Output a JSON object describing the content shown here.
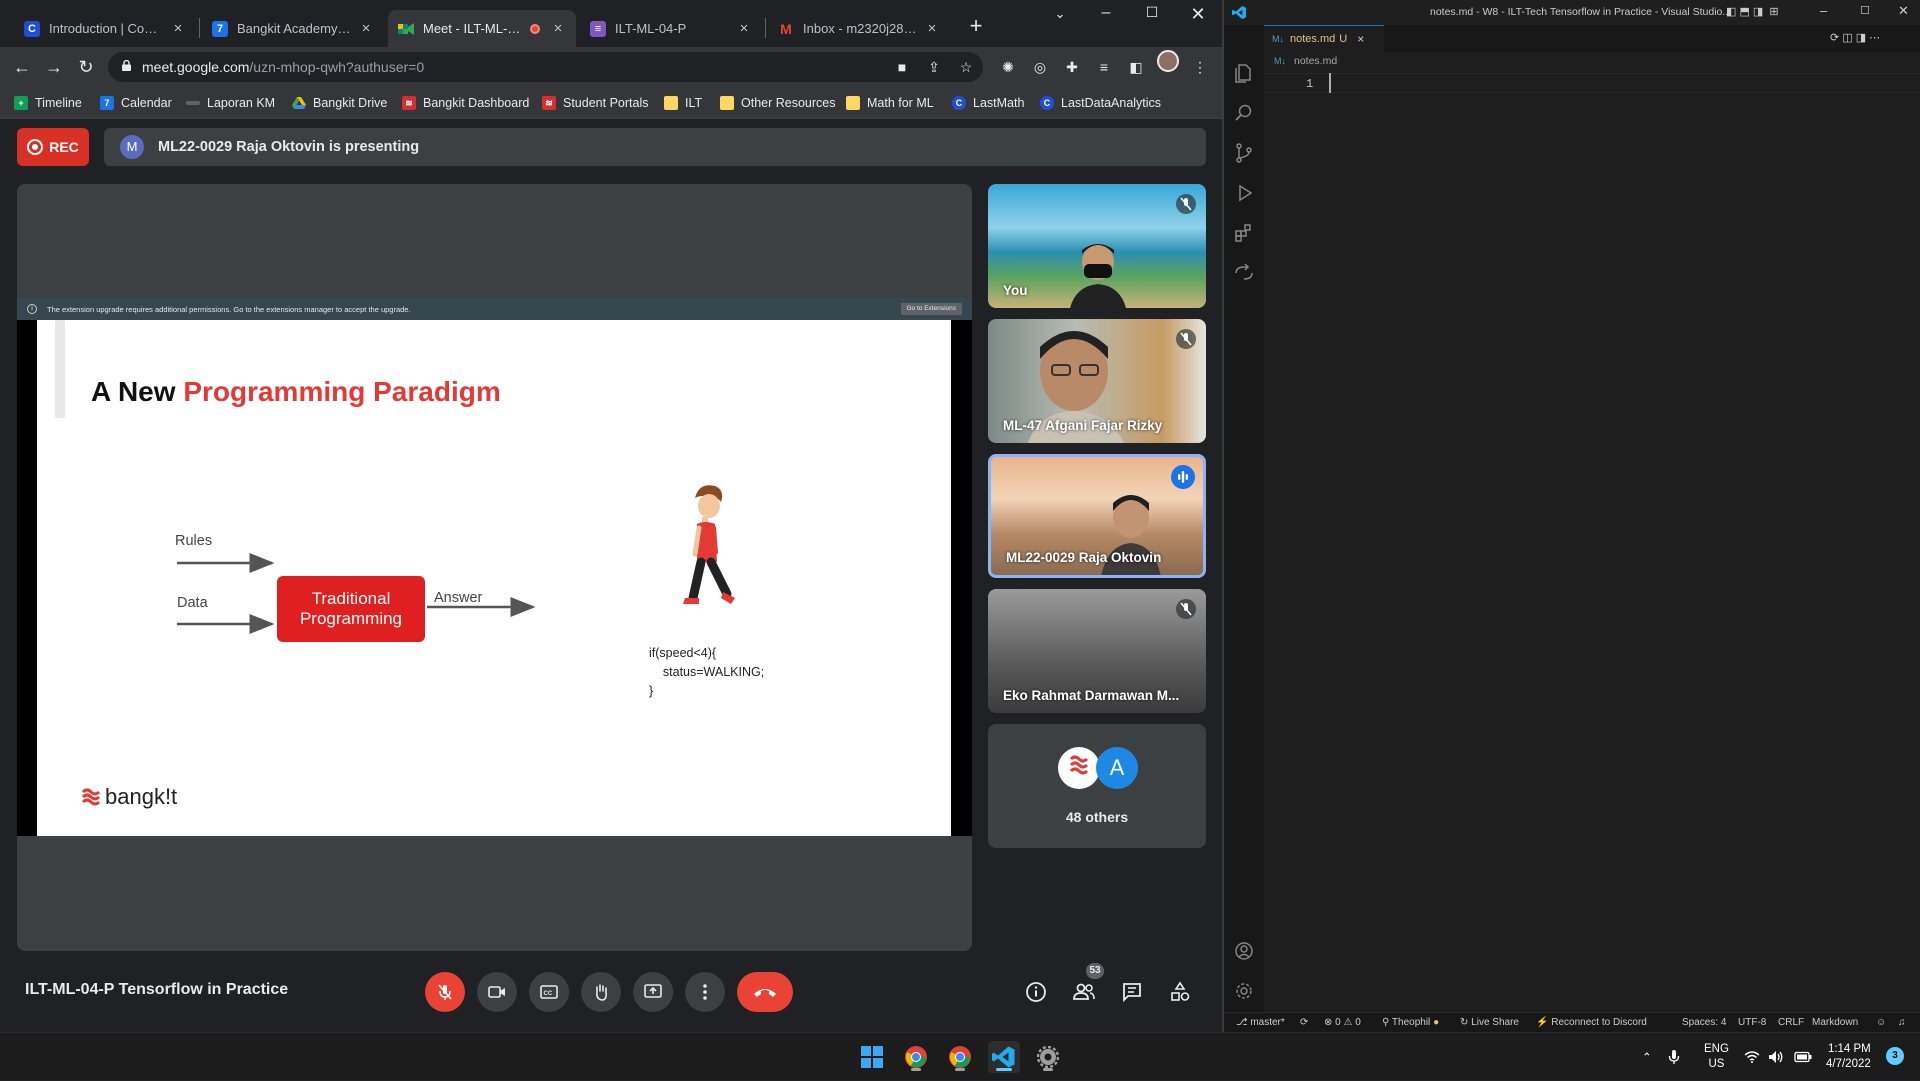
{
  "browser": {
    "tabs": [
      {
        "title": "Introduction | Coursera",
        "favicon": "C",
        "color": "#1f4fd8"
      },
      {
        "title": "Bangkit Academy - Cale",
        "favicon": "7",
        "color": "#1a73e8"
      },
      {
        "title": "Meet - ILT-ML-04-P",
        "favicon": "meet-icon",
        "color": "#00897b"
      },
      {
        "title": "ILT-ML-04-P",
        "favicon": "doc-icon",
        "color": "#7e57c2"
      },
      {
        "title": "Inbox - m2320j2803@",
        "favicon": "M",
        "color": "#ea4335"
      }
    ],
    "url_host": "meet.google.com",
    "url_path": "/uzn-mhop-qwh?authuser=0",
    "bookmarks": [
      "Timeline",
      "Calendar",
      "Laporan KM",
      "Bangkit Drive",
      "Bangkit Dashboard",
      "Student Portals",
      "ILT",
      "Other Resources",
      "Math for ML",
      "LastMath",
      "LastDataAnalytics"
    ]
  },
  "meet": {
    "rec_label": "REC",
    "presenter_initial": "M",
    "presenting_text": "ML22-0029 Raja Oktovin is presenting",
    "extension_notice": "The extension upgrade requires additional permissions. Go to the extensions manager to accept the upgrade.",
    "extension_button": "Go to Extensions",
    "slide": {
      "title_plain": "A New ",
      "title_highlight": "Programming Paradigm",
      "label_rules": "Rules",
      "label_data": "Data",
      "label_answer": "Answer",
      "box_line1": "Traditional",
      "box_line2": "Programming",
      "code": "if(speed<4){\n    status=WALKING;\n}",
      "brand": "bangk!t"
    },
    "participants": [
      {
        "name": "You",
        "muted": true
      },
      {
        "name": "ML-47 Afgani Fajar Rizky",
        "muted": true
      },
      {
        "name": "ML22-0029 Raja Oktovin",
        "muted": false,
        "speaking": true
      },
      {
        "name": "Eko Rahmat Darmawan M...",
        "muted": true
      }
    ],
    "others_avatar_letter": "A",
    "others_label": "48 others",
    "meeting_title": "ILT-ML-04-P Tensorflow in Practice",
    "people_count": "53"
  },
  "vscode": {
    "window_title": "notes.md - W8 - ILT-Tech Tensorflow in Practice - Visual Studio...",
    "tab_name": "notes.md",
    "tab_flag": "U",
    "breadcrumb": "notes.md",
    "line_number": "1",
    "status": {
      "branch": "master*",
      "errors": "0",
      "warnings": "0",
      "user": "Theophil",
      "live_share": "Live Share",
      "discord": "Reconnect to Discord",
      "spaces": "Spaces: 4",
      "encoding": "UTF-8",
      "eol": "CRLF",
      "language": "Markdown"
    }
  },
  "taskbar": {
    "lang_top": "ENG",
    "lang_bottom": "US",
    "time": "1:14 PM",
    "date": "4/7/2022",
    "notification_count": "3"
  },
  "colors": {
    "accent_blue": "#8ab4f8",
    "meet_red": "#ea4335",
    "slide_red": "#e53935"
  }
}
